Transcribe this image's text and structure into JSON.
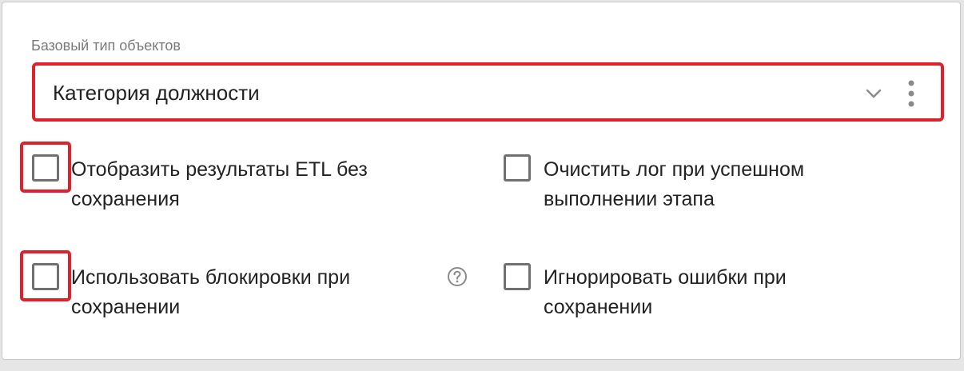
{
  "base_type": {
    "label": "Базовый тип объектов",
    "value": "Категория должности",
    "chevron_icon": "chevron-down-icon",
    "menu_icon": "kebab-menu-icon"
  },
  "options": {
    "show_etl_results": {
      "line1": "Отобразить результаты ETL без",
      "line2": "сохранения",
      "checked": false
    },
    "clear_log": {
      "line1": "Очистить лог при успешном",
      "line2": "выполнении этапа",
      "checked": false
    },
    "use_locks": {
      "line1": "Использовать блокировки при",
      "line2": "сохранении",
      "checked": false,
      "help_icon": "question-circle-icon"
    },
    "ignore_errors": {
      "line1": "Игнорировать ошибки при",
      "line2": "сохранении",
      "checked": false
    }
  },
  "colors": {
    "highlight": "#e0202a",
    "checkbox_border": "#707070",
    "label_gray": "#7a7a7a",
    "text": "#222222"
  }
}
